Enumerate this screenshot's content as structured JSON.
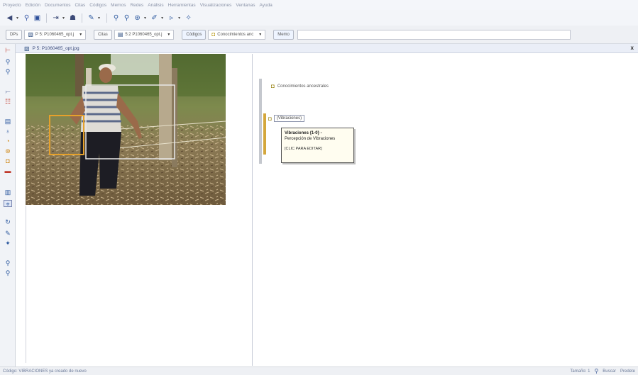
{
  "menubar": {
    "items": [
      "Proyecto",
      "Edición",
      "Documentos",
      "Citas",
      "Códigos",
      "Memos",
      "Redes",
      "Análisis",
      "Herramientas",
      "Visualizaciones",
      "Ventanas",
      "Ayuda"
    ]
  },
  "doc_toolbar": {
    "dps_label": "DPs",
    "doc_combo": "P 5: P1060465_opt.j",
    "citas_label": "Citas",
    "cita_combo": "5:2 P1060465_opt.j",
    "codigos_label": "Códigos",
    "codigo_combo": "Conocimientos anc",
    "memo_label": "Memo"
  },
  "document": {
    "title": "P 5: P1060465_opt.jpg",
    "close_label": "x"
  },
  "margin": {
    "code_1": "Conocimientos ancestrales",
    "code_tag": "(Vibraciones)"
  },
  "tooltip": {
    "title": "Vibraciones {1-0} -",
    "body": "Percepción de Vibraciones",
    "edit": "[CLIC PARA EDITAR]"
  },
  "statusbar": {
    "message": "Código: VIBRACIONES ya creado de nuevo",
    "size_label": "Tamaño: 1",
    "search_label": "Buscar",
    "right_label": "Predete"
  },
  "colors": {
    "accent": "#d4a73c",
    "selection_box": "#e6a12b",
    "quote_box": "#e8e8e8"
  }
}
